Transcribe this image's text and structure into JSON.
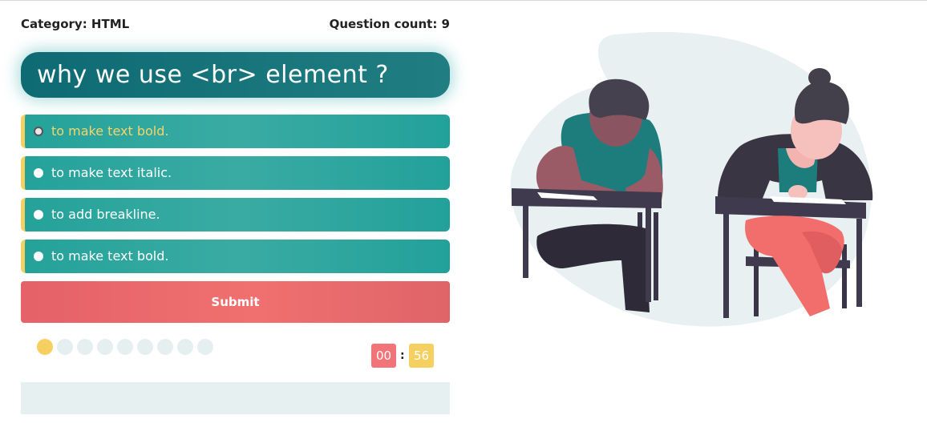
{
  "quiz": {
    "category_text": "Category: HTML",
    "count_text": "Question count: 9",
    "question": "why we use <br> element ?",
    "answers": [
      {
        "label": "to make text bold."
      },
      {
        "label": "to make text italic."
      },
      {
        "label": "to add breakline."
      },
      {
        "label": "to make text bold."
      }
    ],
    "submit_label": "Submit",
    "progress": {
      "total": 9,
      "current": 1
    },
    "timer": {
      "minutes": "00",
      "separator": ":",
      "seconds": "56"
    }
  },
  "colors": {
    "question_bg": "#0e6a73",
    "answer_bg": "#24a29a",
    "answer_border": "#f6cf61",
    "submit_bg": "#f0706f",
    "bullet_active": "#f6cf61",
    "bullet_idle": "#e6eff0",
    "timer_minutes": "#f27378",
    "timer_seconds": "#f6cf61"
  },
  "illustration": {
    "icon": "students-taking-exam-illustration"
  }
}
